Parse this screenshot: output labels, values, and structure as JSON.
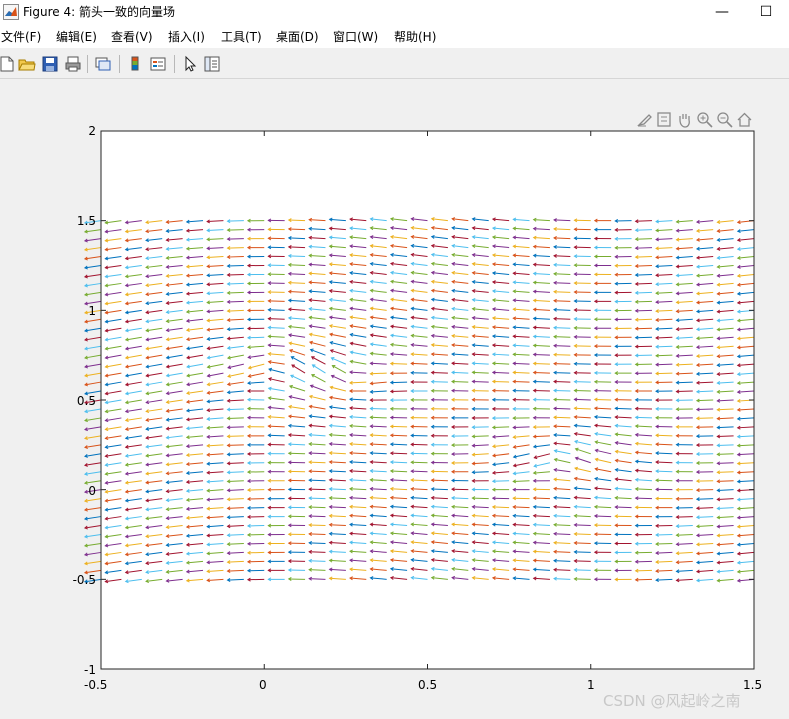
{
  "window": {
    "title": "Figure 4: 箭头一致的向量场",
    "minimize": "—",
    "maximize": "☐"
  },
  "menu": [
    "文件(F)",
    "编辑(E)",
    "查看(V)",
    "插入(I)",
    "工具(T)",
    "桌面(D)",
    "窗口(W)",
    "帮助(H)"
  ],
  "toolbar_icons": [
    "new-figure-icon",
    "open-icon",
    "save-icon",
    "print-icon",
    "link-plot-icon",
    "colorbar-icon",
    "legend-icon",
    "pointer-icon",
    "property-inspector-icon"
  ],
  "axes_toolbar_icons": [
    "brush-icon",
    "data-tips-icon",
    "pan-icon",
    "zoom-in-icon",
    "zoom-out-icon",
    "home-icon"
  ],
  "watermark": "CSDN @风起岭之南",
  "colors": [
    "#0072BD",
    "#D95319",
    "#EDB120",
    "#7E2F8E",
    "#77AC30",
    "#4DBEEE",
    "#A2142F"
  ],
  "chart_data": {
    "type": "quiver",
    "title": "",
    "xlabel": "",
    "ylabel": "",
    "xlim": [
      -0.5,
      1.5
    ],
    "ylim": [
      -1,
      2
    ],
    "x_ticks": [
      "-0.5",
      "0",
      "0.5",
      "1",
      "1.5"
    ],
    "y_ticks": [
      "-1",
      "-0.5",
      "0",
      "0.5",
      "1",
      "1.5",
      "2"
    ],
    "x_tick_values": [
      -0.5,
      0,
      0.5,
      1,
      1.5
    ],
    "y_tick_values": [
      -1,
      -0.5,
      0,
      0.5,
      1,
      1.5,
      2
    ],
    "grid": false,
    "field": {
      "x_range": [
        -0.5,
        1.5
      ],
      "y_range": [
        -0.5,
        1.5
      ],
      "nx": 33,
      "ny": 41,
      "arrow_length": 0.05,
      "general_direction": "left",
      "singular_points": [
        {
          "x": 0.06,
          "y": 0.7
        },
        {
          "x": 0.28,
          "y": 0.6
        },
        {
          "x": 0.92,
          "y": 0.2
        }
      ]
    }
  }
}
